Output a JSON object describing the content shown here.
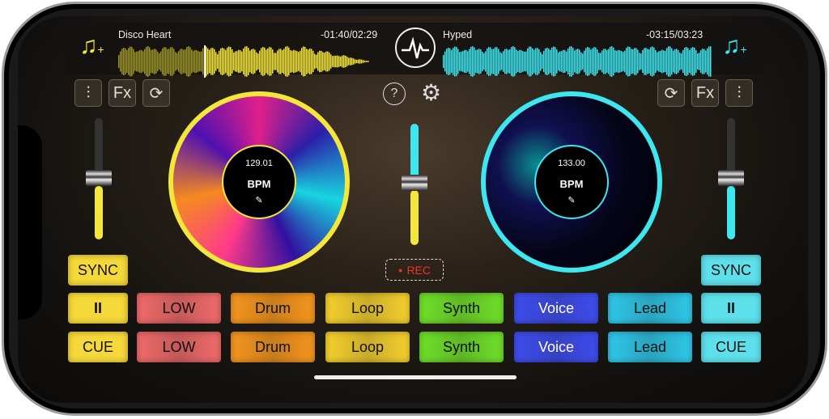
{
  "deck_left": {
    "track_title": "Disco Heart",
    "time": "-01:40/02:29",
    "bpm": "129.01",
    "bpm_label": "BPM",
    "color": "#f5e63a",
    "fx_label": "Fx",
    "progress": 0.33,
    "sync": "SYNC",
    "pause": "II",
    "cue": "CUE"
  },
  "deck_right": {
    "track_title": "Hyped",
    "time": "-03:15/03:23",
    "bpm": "133.00",
    "bpm_label": "BPM",
    "color": "#3ee6f0",
    "fx_label": "Fx",
    "sync": "SYNC",
    "pause": "II",
    "cue": "CUE"
  },
  "rec_label": "REC",
  "pads": [
    {
      "label": "LOW",
      "color": "#f06b6b"
    },
    {
      "label": "Drum",
      "color": "#f5961e"
    },
    {
      "label": "Loop",
      "color": "#f5d02e"
    },
    {
      "label": "Synth",
      "color": "#6fe02a"
    },
    {
      "label": "Voice",
      "color": "#3e4df0"
    },
    {
      "label": "Lead",
      "color": "#2fc8ea"
    }
  ]
}
